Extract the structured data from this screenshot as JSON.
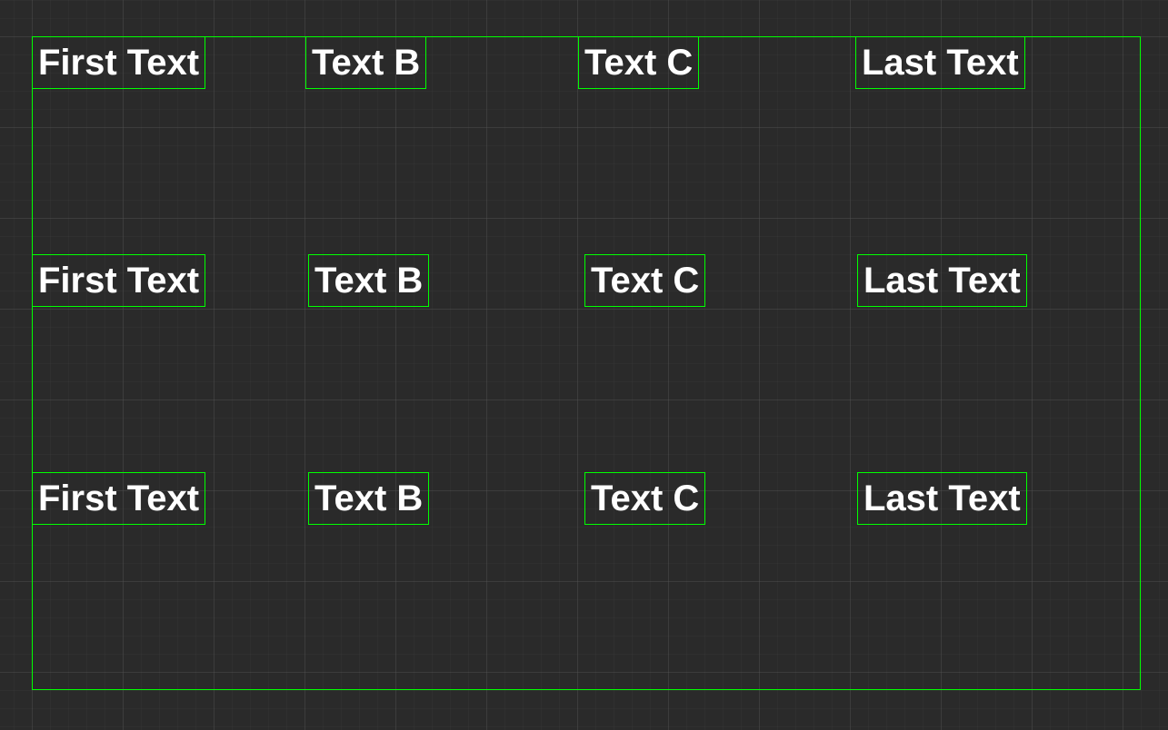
{
  "rows": [
    {
      "cells": [
        {
          "text": "First Text"
        },
        {
          "text": "Text B"
        },
        {
          "text": "Text C"
        },
        {
          "text": "Last Text"
        }
      ]
    },
    {
      "cells": [
        {
          "text": "First Text"
        },
        {
          "text": "Text B"
        },
        {
          "text": "Text C"
        },
        {
          "text": "Last Text"
        }
      ]
    },
    {
      "cells": [
        {
          "text": "First Text"
        },
        {
          "text": "Text B"
        },
        {
          "text": "Text C"
        },
        {
          "text": "Last Text"
        }
      ]
    }
  ]
}
